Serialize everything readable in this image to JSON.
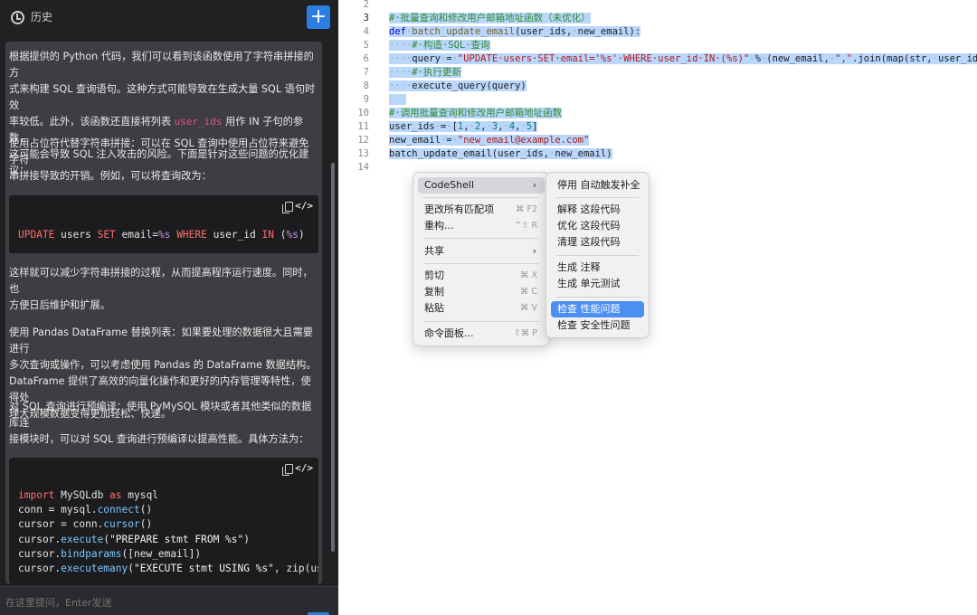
{
  "sidebar": {
    "history_label": "历史",
    "new_button_label": "+",
    "input_placeholder": "在这里提问，Enter发送"
  },
  "chat": {
    "p1a": "根据提供的 Python 代码，我们可以看到该函数使用了字符串拼接的方",
    "p1b": "式来构建 SQL 查询语句。这种方式可能导致在生成大量 SQL 语句时效",
    "p1c_pre": "率较低。此外，该函数还直接将列表 ",
    "p1c_code": "user_ids",
    "p1c_post": " 用作 IN 子句的参数，",
    "p1d": "这可能会导致 SQL 注入攻击的风险。下面是针对这些问题的优化建议：",
    "p2a": "使用占位符代替字符串拼接：可以在 SQL 查询中使用占位符来避免字符",
    "p2b": "串拼接导致的开销。例如，可以将查询改为：",
    "code1": "UPDATE users SET email=%s WHERE user_id IN (%s)",
    "p3a": "这样就可以减少字符串拼接的过程，从而提高程序运行速度。同时，也",
    "p3b": "方便日后维护和扩展。",
    "p4a": "使用 Pandas DataFrame 替换列表：如果要处理的数据很大且需要进行",
    "p4b": "多次查询或操作，可以考虑使用 Pandas 的 DataFrame 数据结构。",
    "p4c": "DataFrame 提供了高效的向量化操作和更好的内存管理等特性，使得处",
    "p4d": "理大规模数据变得更加轻松、快速。",
    "p5a": "对 SQL 查询进行预编译：使用 PyMySQL 模块或者其他类似的数据库连",
    "p5b": "接模块时，可以对 SQL 查询进行预编译以提高性能。具体方法为：",
    "code2": [
      "import MySQLdb as mysql",
      "conn = mysql.connect()",
      "cursor = conn.cursor()",
      "cursor.execute(\"PREPARE stmt FROM %s\")",
      "cursor.bindparams([new_email])",
      "cursor.executemany(\"EXECUTE stmt USING %s\", zip(use"
    ]
  },
  "editor": {
    "line_numbers": [
      "2",
      "3",
      "4",
      "5",
      "6",
      "7",
      "8",
      "9",
      "10",
      "11",
      "12",
      "13",
      "14"
    ],
    "lines": [
      "",
      "# 批量查询和修改用户邮箱地址函数（未优化）",
      "def batch_update_email(user_ids, new_email):",
      "    # 构造 SQL 查询",
      "    query = \"UPDATE users SET email='%s' WHERE user_id IN (%s)\" % (new_email, \",\".join(map(str, user_ids)))",
      "    # 执行更新",
      "    execute_query(query)",
      "",
      "# 调用批量查询和修改用户邮箱地址函数",
      "user_ids = [1, 2, 3, 4, 5]",
      "new_email = \"new_email@example.com\"",
      "batch_update_email(user_ids, new_email)",
      ""
    ]
  },
  "context_menu": {
    "codeshell": "CodeShell",
    "change_all": "更改所有匹配项",
    "change_all_sc": "⌘ F2",
    "refactor": "重构...",
    "refactor_sc": "^⇧ R",
    "share": "共享",
    "cut": "剪切",
    "cut_sc": "⌘ X",
    "copy": "复制",
    "copy_sc": "⌘ C",
    "paste": "粘贴",
    "paste_sc": "⌘ V",
    "command_palette": "命令面板...",
    "command_palette_sc": "⇧⌘ P"
  },
  "submenu": {
    "disable_autocomplete": "停用 自动触发补全",
    "explain": "解释 这段代码",
    "optimize": "优化 这段代码",
    "clean": "清理 这段代码",
    "gen_comment": "生成 注释",
    "gen_test": "生成 单元测试",
    "check_perf": "检查 性能问题",
    "check_security": "检查 安全性问题"
  }
}
